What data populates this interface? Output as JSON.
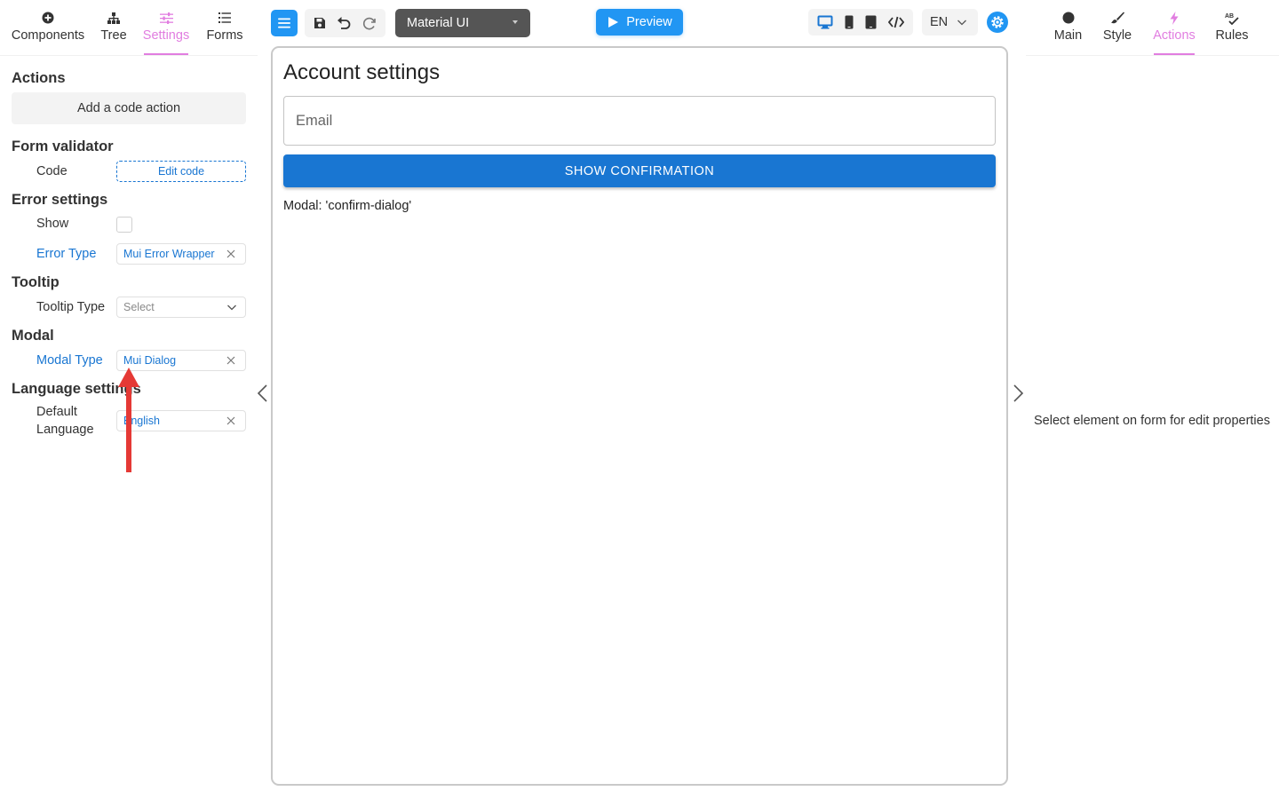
{
  "left_tabs": [
    {
      "label": "Components",
      "icon": "plus-circle-icon"
    },
    {
      "label": "Tree",
      "icon": "tree-icon"
    },
    {
      "label": "Settings",
      "icon": "sliders-icon"
    },
    {
      "label": "Forms",
      "icon": "list-icon"
    }
  ],
  "left_active_tab": "Settings",
  "settings": {
    "actions_title": "Actions",
    "add_code_action": "Add a code action",
    "form_validator_title": "Form validator",
    "code_label": "Code",
    "edit_code": "Edit code",
    "error_settings_title": "Error settings",
    "show_label": "Show",
    "show_checked": false,
    "error_type_label": "Error Type",
    "error_type_value": "Mui Error Wrapper",
    "tooltip_title": "Tooltip",
    "tooltip_type_label": "Tooltip Type",
    "tooltip_type_placeholder": "Select",
    "modal_title": "Modal",
    "modal_type_label": "Modal Type",
    "modal_type_value": "Mui Dialog",
    "language_title": "Language settings",
    "default_language_label_1": "Default",
    "default_language_label_2": "Language",
    "default_language_value": "English"
  },
  "toolbar": {
    "theme": "Material UI",
    "preview": "Preview",
    "language": "EN"
  },
  "canvas": {
    "title": "Account settings",
    "email_placeholder": "Email",
    "confirm_button": "SHOW CONFIRMATION",
    "modal_text": "Modal: 'confirm-dialog'"
  },
  "right_tabs": [
    {
      "label": "Main",
      "icon": "circle-icon"
    },
    {
      "label": "Style",
      "icon": "brush-icon"
    },
    {
      "label": "Actions",
      "icon": "lightning-icon"
    },
    {
      "label": "Rules",
      "icon": "spellcheck-icon"
    }
  ],
  "right_active_tab": "Actions",
  "right_message": "Select element on form for edit properties",
  "colors": {
    "accent_pink": "#e17de0",
    "primary_blue": "#1976d2",
    "toolbar_blue": "#2196f3",
    "annotation_red": "#e53935"
  }
}
